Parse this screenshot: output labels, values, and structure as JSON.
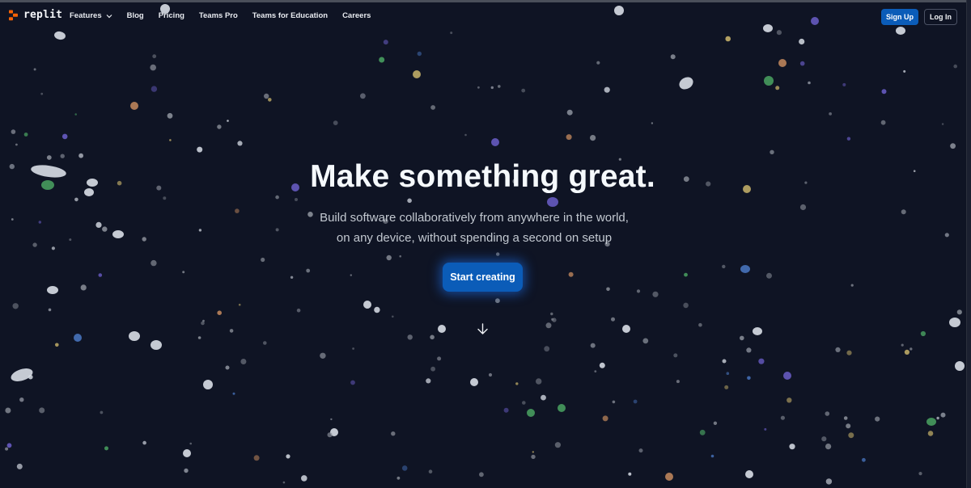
{
  "nav": {
    "logo_text": "replit",
    "links": [
      "Features",
      "Blog",
      "Pricing",
      "Teams Pro",
      "Teams for Education",
      "Careers"
    ],
    "signup_label": "Sign Up",
    "login_label": "Log In"
  },
  "hero": {
    "title": "Make something great.",
    "subtitle_line1": "Build software collaboratively from anywhere in the world,",
    "subtitle_line2": "on any device, without spending a second on setup",
    "cta_label": "Start creating"
  },
  "colors": {
    "background": "#0f1424",
    "accent_blue": "#0b5cb8",
    "logo_orange": "#f26207",
    "confetti": [
      "#d5dae3",
      "#8a8f99",
      "#6b5ec9",
      "#c58a5e",
      "#4aa362",
      "#c9b46b",
      "#4a78c4"
    ]
  },
  "icons": {
    "logo": "replit-logo-icon",
    "features_dropdown": "chevron-down-icon",
    "scroll": "arrow-down-icon"
  }
}
